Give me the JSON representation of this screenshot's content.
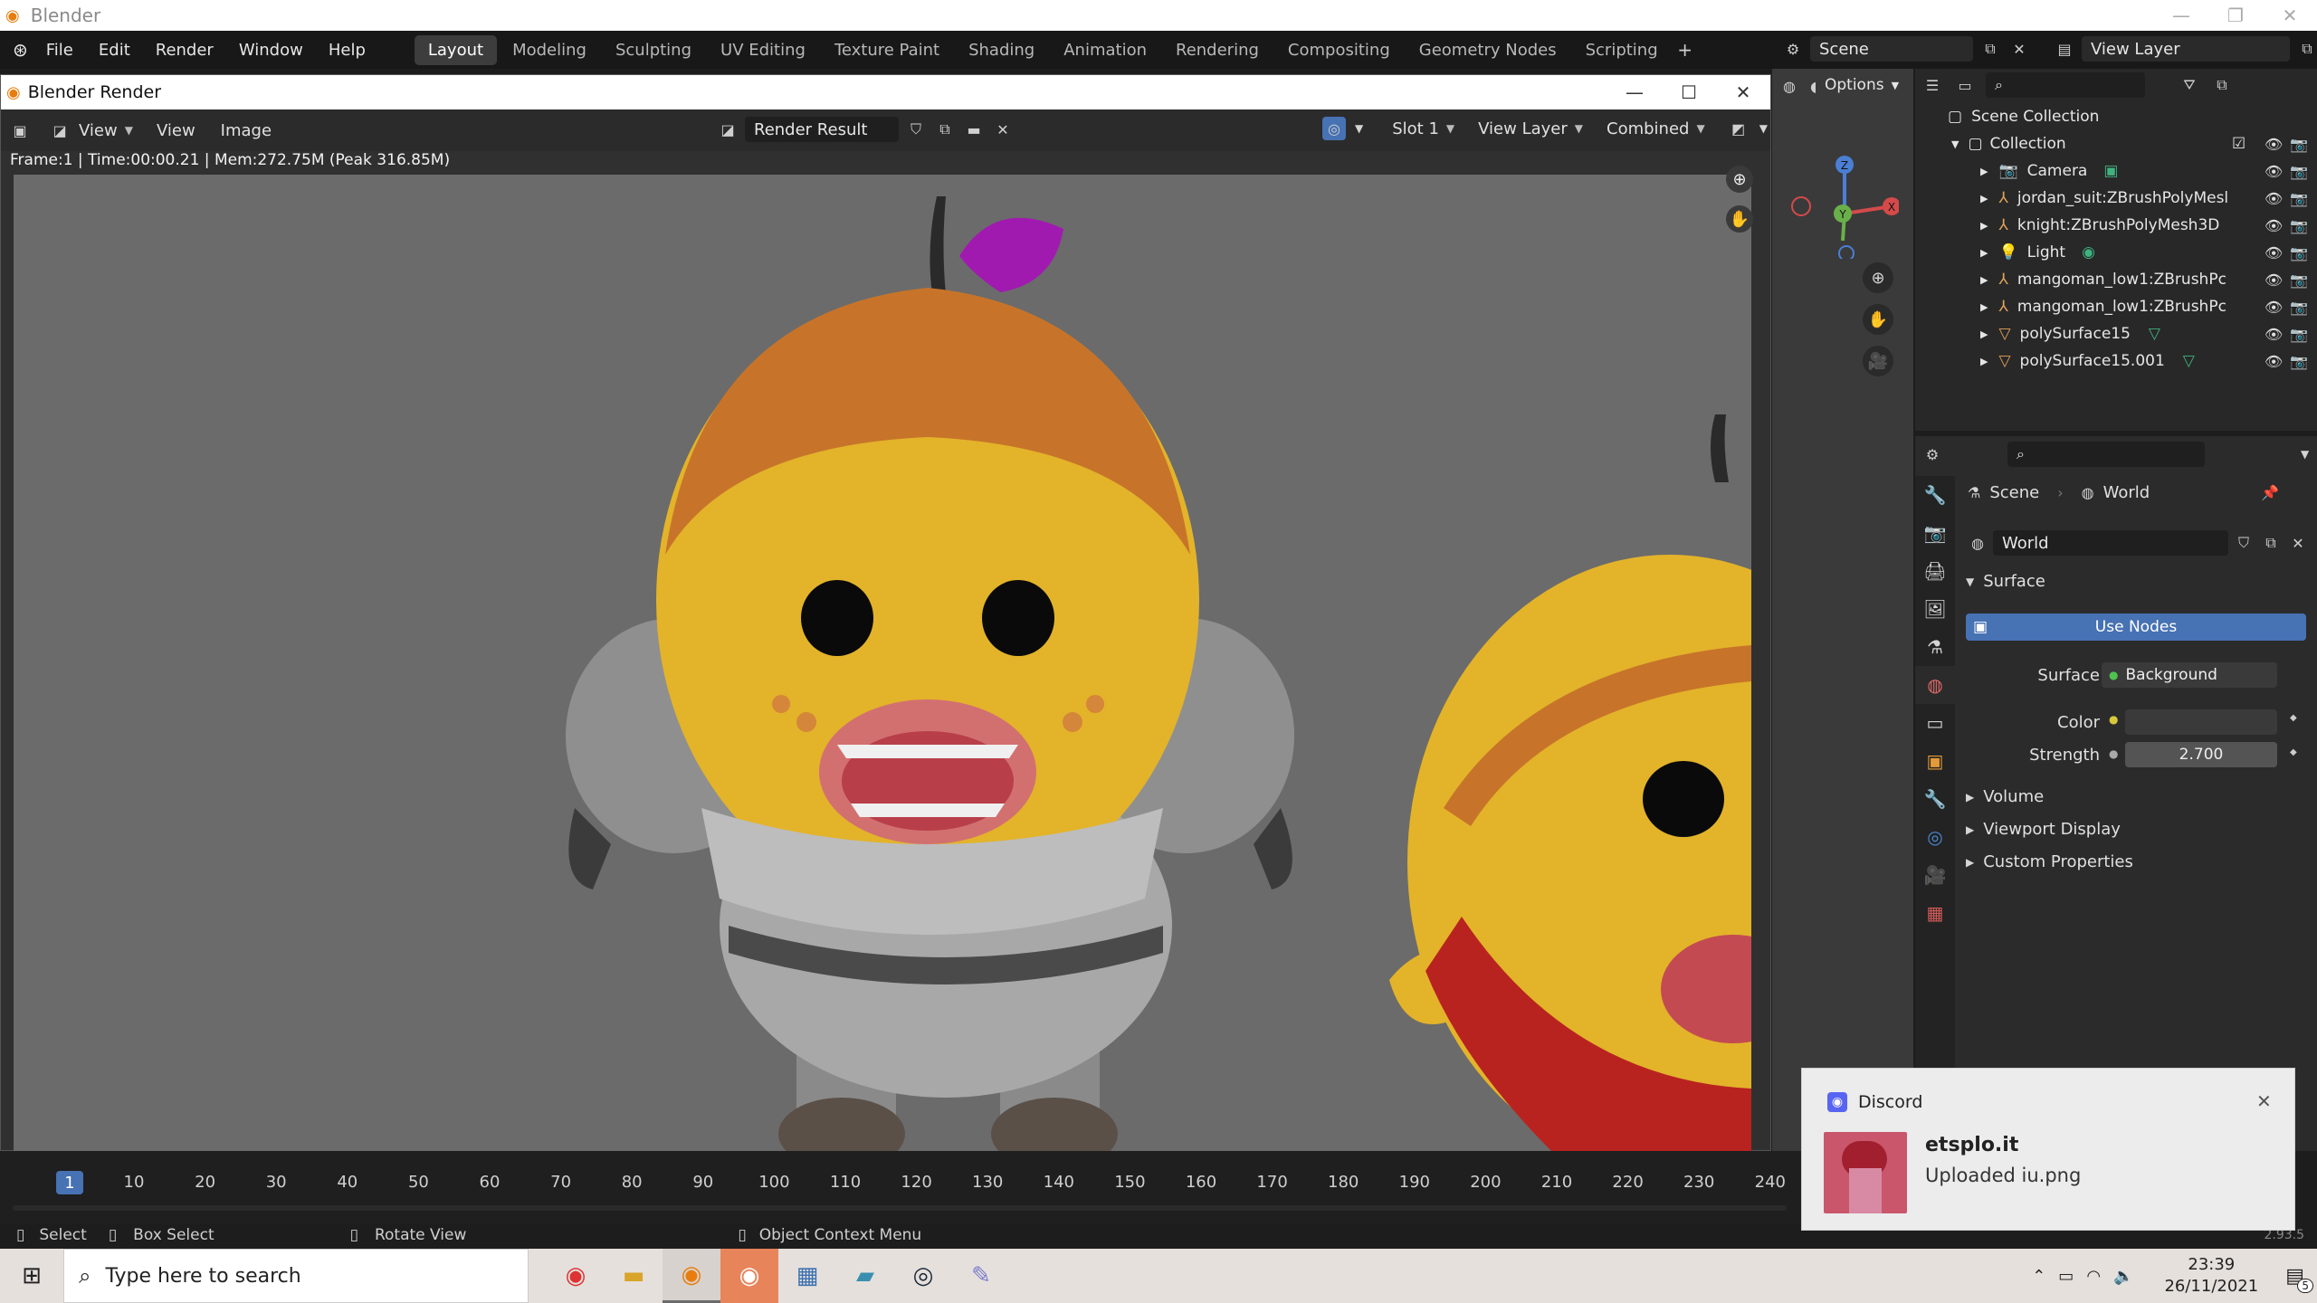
{
  "os": {
    "window_title": "Blender"
  },
  "menu": [
    "File",
    "Edit",
    "Render",
    "Window",
    "Help"
  ],
  "workspaces": [
    "Layout",
    "Modeling",
    "Sculpting",
    "UV Editing",
    "Texture Paint",
    "Shading",
    "Animation",
    "Rendering",
    "Compositing",
    "Geometry Nodes",
    "Scripting"
  ],
  "active_workspace": "Layout",
  "scene_field": "Scene",
  "view_layer_field": "View Layer",
  "render_window": {
    "title": "Blender Render",
    "menus": [
      "View",
      "Image"
    ],
    "image_name": "Render Result",
    "slot": "Slot 1",
    "view_layer": "View Layer",
    "pass": "Combined",
    "meta": "Frame:1 | Time:00:00.21 | Mem:272.75M (Peak 316.85M)"
  },
  "viewport": {
    "options_label": "Options",
    "axes": {
      "x": "X",
      "y": "Y",
      "z": "Z"
    }
  },
  "outliner": {
    "root": "Scene Collection",
    "collection": "Collection",
    "items": [
      {
        "name": "Camera",
        "icon": "camera-icon"
      },
      {
        "name": "jordan_suit:ZBrushPolyMesl",
        "icon": "armature-icon"
      },
      {
        "name": "knight:ZBrushPolyMesh3D",
        "icon": "armature-icon"
      },
      {
        "name": "Light",
        "icon": "light-icon"
      },
      {
        "name": "mangoman_low1:ZBrushPc",
        "icon": "armature-icon"
      },
      {
        "name": "mangoman_low1:ZBrushPc",
        "icon": "armature-icon"
      },
      {
        "name": "polySurface15",
        "icon": "mesh-icon"
      },
      {
        "name": "polySurface15.001",
        "icon": "mesh-icon"
      }
    ]
  },
  "properties": {
    "breadcrumb_scene": "Scene",
    "breadcrumb_world": "World",
    "world_name": "World",
    "panel_surface": "Surface",
    "use_nodes": "Use Nodes",
    "surface_label": "Surface",
    "surface_value": "Background",
    "color_label": "Color",
    "strength_label": "Strength",
    "strength_value": "2.700",
    "collapsed_panels": [
      "Volume",
      "Viewport Display",
      "Custom Properties"
    ]
  },
  "timeline": {
    "current_frame": "1",
    "ticks": [
      "10",
      "20",
      "30",
      "40",
      "50",
      "60",
      "70",
      "80",
      "90",
      "100",
      "110",
      "120",
      "130",
      "140",
      "150",
      "160",
      "170",
      "180",
      "190",
      "200",
      "210",
      "220",
      "230",
      "240"
    ],
    "version": "2.93.5"
  },
  "statusbar": {
    "select": "Select",
    "box_select": "Box Select",
    "rotate_view": "Rotate View",
    "context_menu": "Object Context Menu"
  },
  "toast": {
    "app": "Discord",
    "title": "etsplo.it",
    "message": "Uploaded iu.png"
  },
  "taskbar": {
    "search_placeholder": "Type here to search",
    "time": "23:39",
    "date": "26/11/2021",
    "badge": "5"
  }
}
